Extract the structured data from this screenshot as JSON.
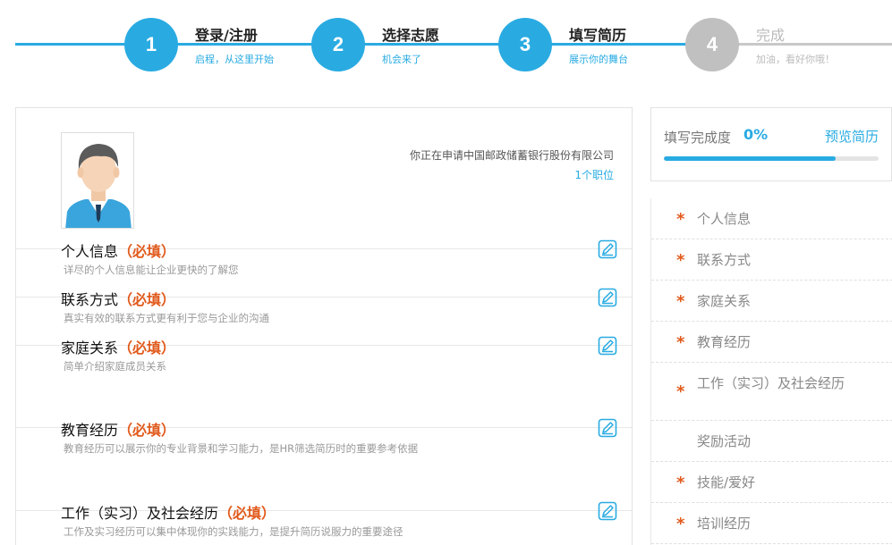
{
  "stepper": {
    "steps": [
      {
        "number": "1",
        "title": "登录/注册",
        "subtitle": "启程，从这里开始"
      },
      {
        "number": "2",
        "title": "选择志愿",
        "subtitle": "机会来了"
      },
      {
        "number": "3",
        "title": "填写简历",
        "subtitle": "展示你的舞台"
      },
      {
        "number": "4",
        "title": "完成",
        "subtitle": "加油，看好你哦！"
      }
    ]
  },
  "main": {
    "applying_to": "你正在申请中国邮政储蓄银行股份有限公司",
    "positions_link": "1个职位",
    "required_mark": "（必填）",
    "sections": [
      {
        "title": "个人信息",
        "desc": "详尽的个人信息能让企业更快的了解您"
      },
      {
        "title": "联系方式",
        "desc": "真实有效的联系方式更有利于您与企业的沟通"
      },
      {
        "title": "家庭关系",
        "desc": "简单介绍家庭成员关系"
      },
      {
        "title": "教育经历",
        "desc": "教育经历可以展示你的专业背景和学习能力，是HR筛选简历时的重要参考依据"
      },
      {
        "title": "工作（实习）及社会经历",
        "desc": "工作及实习经历可以集中体现你的实践能力，是提升简历说服力的重要途径"
      }
    ]
  },
  "progress": {
    "label": "填写完成度",
    "percent_text": "0%",
    "bar_fill_percent": 80,
    "preview_label": "预览简历"
  },
  "side_nav": {
    "star": "*",
    "items": [
      {
        "label": "个人信息",
        "required": true
      },
      {
        "label": "联系方式",
        "required": true
      },
      {
        "label": "家庭关系",
        "required": true
      },
      {
        "label": "教育经历",
        "required": true
      },
      {
        "label": "工作（实习）及社会经历",
        "required": true
      },
      {
        "label": "奖励活动",
        "required": false
      },
      {
        "label": "技能/爱好",
        "required": true
      },
      {
        "label": "培训经历",
        "required": true
      }
    ]
  },
  "colors": {
    "accent": "#29abe2",
    "required": "#e15a1c",
    "inactive": "#c0c0c0"
  }
}
